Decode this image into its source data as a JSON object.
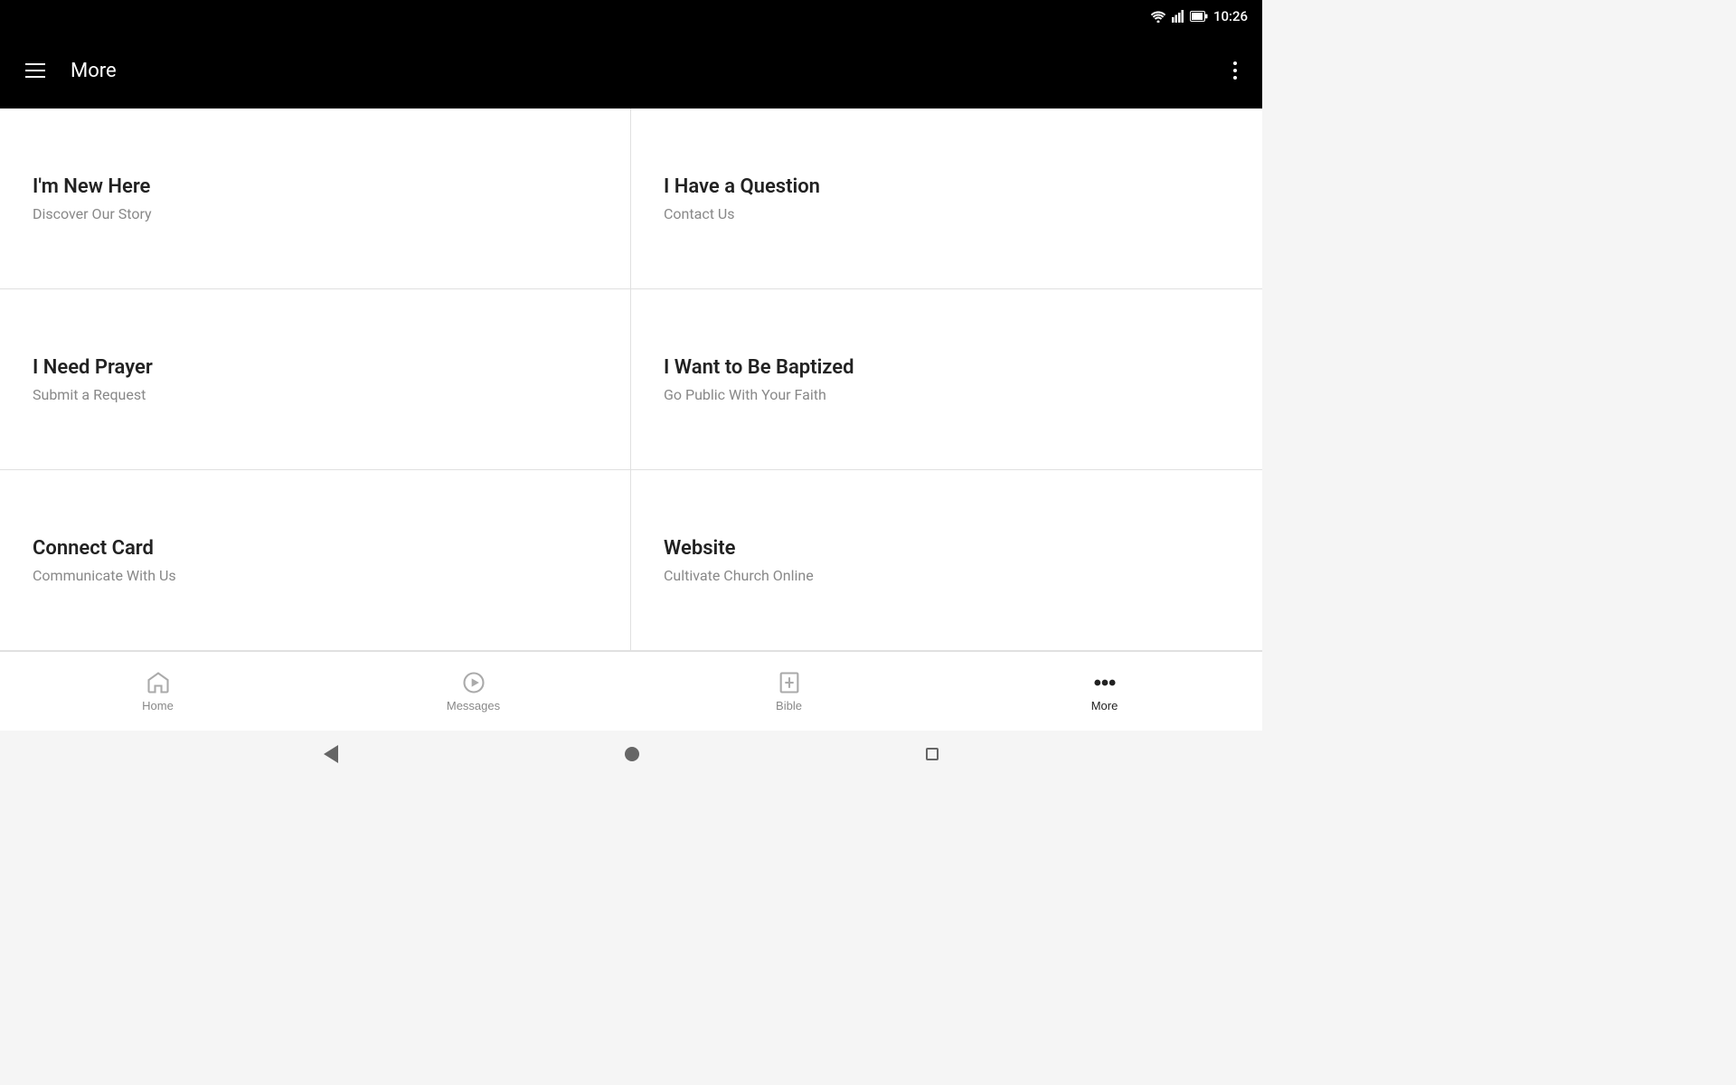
{
  "status_bar": {
    "time": "10:26"
  },
  "app_bar": {
    "title": "More",
    "menu_icon": "menu-icon",
    "overflow_icon": "overflow-icon"
  },
  "grid_items": [
    {
      "title": "I'm New Here",
      "subtitle": "Discover Our Story"
    },
    {
      "title": "I Have a Question",
      "subtitle": "Contact Us"
    },
    {
      "title": "I Need Prayer",
      "subtitle": "Submit a Request"
    },
    {
      "title": "I Want to Be Baptized",
      "subtitle": "Go Public With Your Faith"
    },
    {
      "title": "Connect Card",
      "subtitle": "Communicate With Us"
    },
    {
      "title": "Website",
      "subtitle": "Cultivate Church Online"
    }
  ],
  "bottom_nav": {
    "items": [
      {
        "label": "Home",
        "icon": "home-icon",
        "active": false
      },
      {
        "label": "Messages",
        "icon": "messages-icon",
        "active": false
      },
      {
        "label": "Bible",
        "icon": "bible-icon",
        "active": false
      },
      {
        "label": "More",
        "icon": "more-icon",
        "active": true
      }
    ]
  }
}
